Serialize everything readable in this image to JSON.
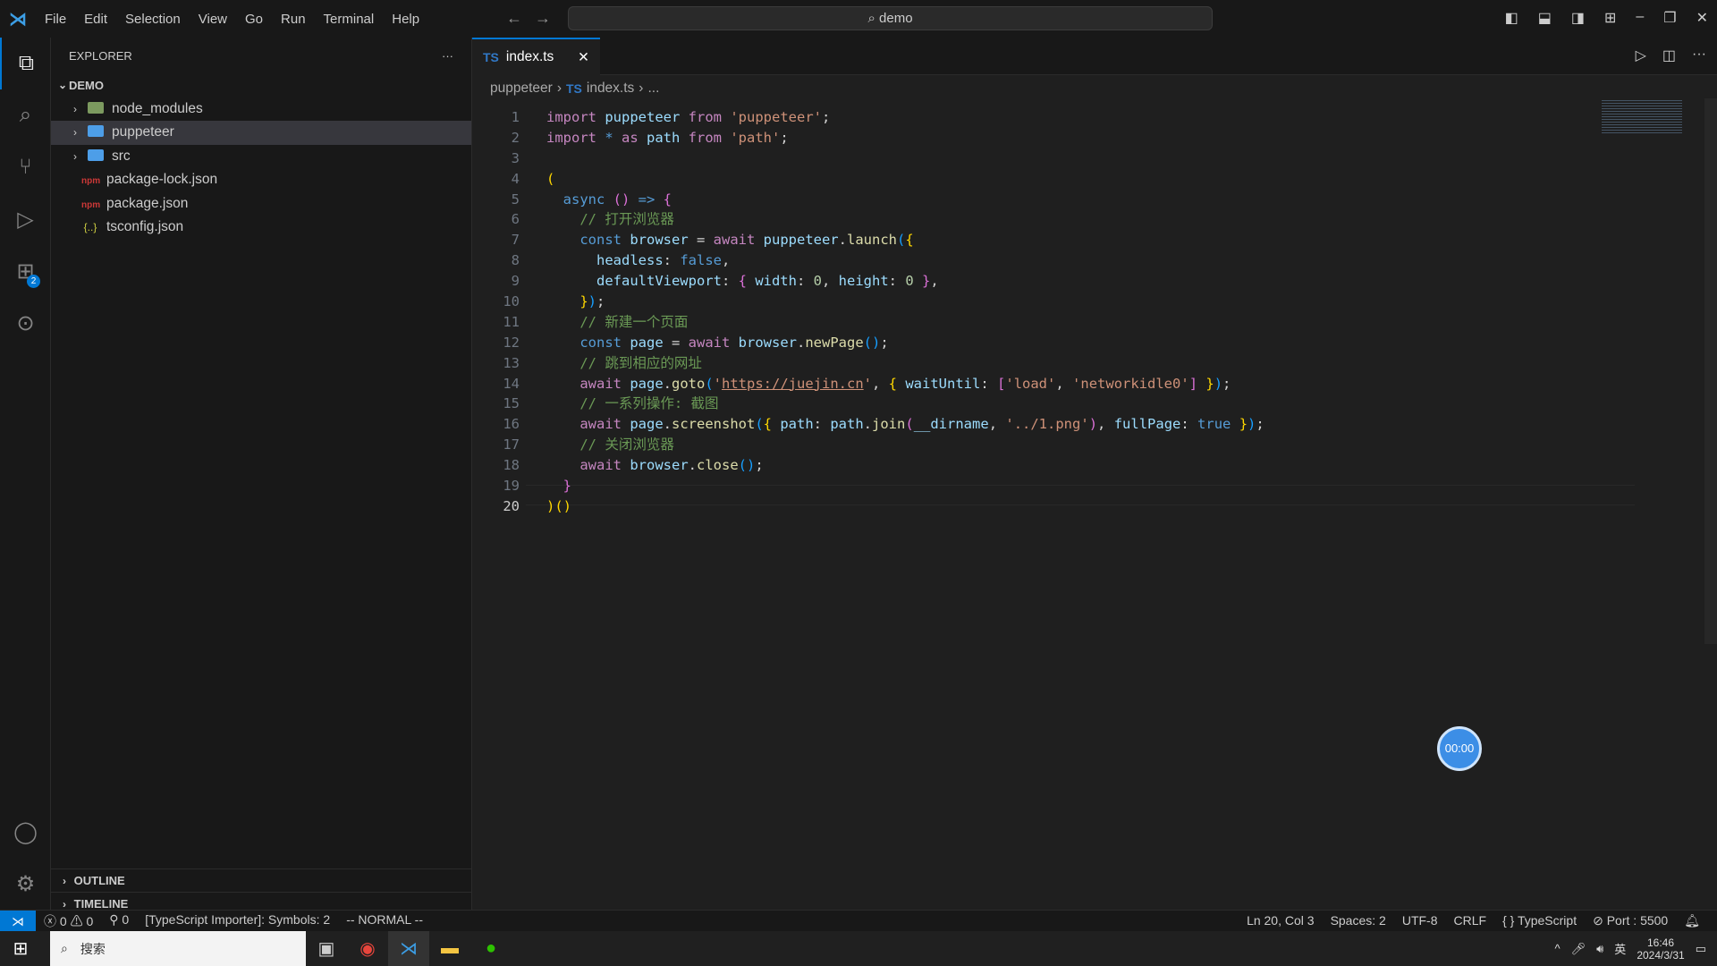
{
  "menu": [
    "File",
    "Edit",
    "Selection",
    "View",
    "Go",
    "Run",
    "Terminal",
    "Help"
  ],
  "search": "demo",
  "explorer": {
    "title": "EXPLORER",
    "root": "DEMO",
    "items": [
      {
        "name": "node_modules",
        "type": "folder-special"
      },
      {
        "name": "puppeteer",
        "type": "folder",
        "selected": true
      },
      {
        "name": "src",
        "type": "folder"
      },
      {
        "name": "package-lock.json",
        "type": "npm"
      },
      {
        "name": "package.json",
        "type": "npm"
      },
      {
        "name": "tsconfig.json",
        "type": "json"
      }
    ],
    "outline": "OUTLINE",
    "timeline": "TIMELINE"
  },
  "extensions_badge": "2",
  "tab": {
    "lang": "TS",
    "label": "index.ts"
  },
  "breadcrumb": [
    "puppeteer",
    "index.ts",
    "..."
  ],
  "code": [
    [
      [
        "import ",
        "kw"
      ],
      [
        "puppeteer ",
        "var"
      ],
      [
        "from ",
        "kw"
      ],
      [
        "'puppeteer'",
        "str"
      ],
      [
        ";",
        "p"
      ]
    ],
    [
      [
        "import ",
        "kw"
      ],
      [
        "* ",
        "st"
      ],
      [
        "as ",
        "kw"
      ],
      [
        "path ",
        "var"
      ],
      [
        "from ",
        "kw"
      ],
      [
        "'path'",
        "str"
      ],
      [
        ";",
        "p"
      ]
    ],
    [],
    [
      [
        "(",
        "b1"
      ]
    ],
    [
      [
        "  async ",
        "st"
      ],
      [
        "() ",
        "b2"
      ],
      [
        "=> ",
        "st"
      ],
      [
        "{",
        "b2"
      ]
    ],
    [
      [
        "    // 打开浏览器",
        "com"
      ]
    ],
    [
      [
        "    const ",
        "st"
      ],
      [
        "browser ",
        "var"
      ],
      [
        "= ",
        "p"
      ],
      [
        "await ",
        "kw"
      ],
      [
        "puppeteer",
        "var"
      ],
      [
        ".",
        "p"
      ],
      [
        "launch",
        "fn"
      ],
      [
        "(",
        "b3"
      ],
      [
        "{",
        "b1"
      ]
    ],
    [
      [
        "      headless",
        "var"
      ],
      [
        ": ",
        "p"
      ],
      [
        "false",
        "st"
      ],
      [
        ",",
        "p"
      ]
    ],
    [
      [
        "      defaultViewport",
        "var"
      ],
      [
        ": ",
        "p"
      ],
      [
        "{ ",
        "b2"
      ],
      [
        "width",
        "var"
      ],
      [
        ": ",
        "p"
      ],
      [
        "0",
        "num"
      ],
      [
        ", ",
        "p"
      ],
      [
        "height",
        "var"
      ],
      [
        ": ",
        "p"
      ],
      [
        "0 ",
        "num"
      ],
      [
        "}",
        "b2"
      ],
      [
        ",",
        "p"
      ]
    ],
    [
      [
        "    }",
        "b1"
      ],
      [
        ")",
        "b3"
      ],
      [
        ";",
        "p"
      ]
    ],
    [
      [
        "    // 新建一个页面",
        "com"
      ]
    ],
    [
      [
        "    const ",
        "st"
      ],
      [
        "page ",
        "var"
      ],
      [
        "= ",
        "p"
      ],
      [
        "await ",
        "kw"
      ],
      [
        "browser",
        "var"
      ],
      [
        ".",
        "p"
      ],
      [
        "newPage",
        "fn"
      ],
      [
        "()",
        "b3"
      ],
      [
        ";",
        "p"
      ]
    ],
    [
      [
        "    // 跳到相应的网址",
        "com"
      ]
    ],
    [
      [
        "    await ",
        "kw"
      ],
      [
        "page",
        "var"
      ],
      [
        ".",
        "p"
      ],
      [
        "goto",
        "fn"
      ],
      [
        "(",
        "b3"
      ],
      [
        "'",
        "str"
      ],
      [
        "https://juejin.cn",
        "url"
      ],
      [
        "'",
        "str"
      ],
      [
        ", ",
        "p"
      ],
      [
        "{ ",
        "b1"
      ],
      [
        "waitUntil",
        "var"
      ],
      [
        ": ",
        "p"
      ],
      [
        "[",
        "b2"
      ],
      [
        "'load'",
        "str"
      ],
      [
        ", ",
        "p"
      ],
      [
        "'networkidle0'",
        "str"
      ],
      [
        "] ",
        "b2"
      ],
      [
        "}",
        "b1"
      ],
      [
        ")",
        "b3"
      ],
      [
        ";",
        "p"
      ]
    ],
    [
      [
        "    // 一系列操作: 截图",
        "com"
      ]
    ],
    [
      [
        "    await ",
        "kw"
      ],
      [
        "page",
        "var"
      ],
      [
        ".",
        "p"
      ],
      [
        "screenshot",
        "fn"
      ],
      [
        "(",
        "b3"
      ],
      [
        "{ ",
        "b1"
      ],
      [
        "path",
        "var"
      ],
      [
        ": ",
        "p"
      ],
      [
        "path",
        "var"
      ],
      [
        ".",
        "p"
      ],
      [
        "join",
        "fn"
      ],
      [
        "(",
        "b2"
      ],
      [
        "__dirname",
        "var"
      ],
      [
        ", ",
        "p"
      ],
      [
        "'../1.png'",
        "str"
      ],
      [
        ")",
        "b2"
      ],
      [
        ", ",
        "p"
      ],
      [
        "fullPage",
        "var"
      ],
      [
        ": ",
        "p"
      ],
      [
        "true ",
        "st"
      ],
      [
        "}",
        "b1"
      ],
      [
        ")",
        "b3"
      ],
      [
        ";",
        "p"
      ]
    ],
    [
      [
        "    // 关闭浏览器",
        "com"
      ]
    ],
    [
      [
        "    await ",
        "kw"
      ],
      [
        "browser",
        "var"
      ],
      [
        ".",
        "p"
      ],
      [
        "close",
        "fn"
      ],
      [
        "()",
        "b3"
      ],
      [
        ";",
        "p"
      ]
    ],
    [
      [
        "  }",
        "b2"
      ]
    ],
    [
      [
        ")",
        "b1"
      ],
      [
        "()",
        "b1"
      ]
    ]
  ],
  "current_line": 20,
  "timer": "00:00",
  "status": {
    "errors": "0",
    "warnings": "0",
    "ports": "0",
    "importer": "[TypeScript Importer]: Symbols: 2",
    "mode": "-- NORMAL --",
    "position": "Ln 20, Col 3",
    "spaces": "Spaces: 2",
    "encoding": "UTF-8",
    "eol": "CRLF",
    "language": "TypeScript",
    "port": "Port : 5500"
  },
  "taskbar": {
    "search": "搜索",
    "time": "16:46",
    "date": "2024/3/31",
    "ime": "英"
  }
}
